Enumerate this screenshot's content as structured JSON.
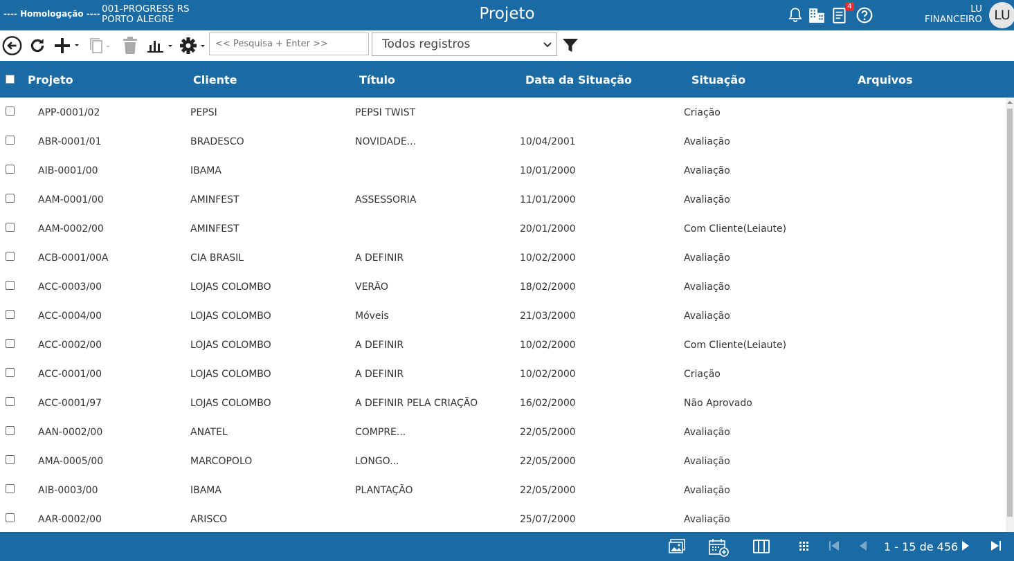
{
  "header": {
    "environment": "---- Homologação ----",
    "company_line1": "001-PROGRESS RS",
    "company_line2": "PORTO ALEGRE",
    "title": "Projeto",
    "notification_count": "4",
    "user_line1": "LU",
    "user_line2": "FINANCEIRO",
    "avatar_initials": "LU"
  },
  "toolbar": {
    "search_placeholder": "<< Pesquisa + Enter >>",
    "filter_selected": "Todos registros"
  },
  "table": {
    "columns": [
      "Projeto",
      "Cliente",
      "Título",
      "Data da Situação",
      "Situação",
      "Arquivos"
    ],
    "rows": [
      {
        "projeto": "APP-0001/02",
        "cliente": "PEPSI",
        "titulo": "PEPSI TWIST",
        "data": "",
        "situacao": "Criação"
      },
      {
        "projeto": "ABR-0001/01",
        "cliente": "BRADESCO",
        "titulo": "NOVIDADE...",
        "data": "10/04/2001",
        "situacao": "Avaliação"
      },
      {
        "projeto": "AIB-0001/00",
        "cliente": "IBAMA",
        "titulo": "",
        "data": "10/01/2000",
        "situacao": "Avaliação"
      },
      {
        "projeto": "AAM-0001/00",
        "cliente": "AMINFEST",
        "titulo": "ASSESSORIA",
        "data": "11/01/2000",
        "situacao": "Avaliação"
      },
      {
        "projeto": "AAM-0002/00",
        "cliente": "AMINFEST",
        "titulo": "",
        "data": "20/01/2000",
        "situacao": "Com Cliente(Leiaute)"
      },
      {
        "projeto": "ACB-0001/00A",
        "cliente": "CIA BRASIL",
        "titulo": "A DEFINIR",
        "data": "10/02/2000",
        "situacao": "Avaliação"
      },
      {
        "projeto": "ACC-0003/00",
        "cliente": "LOJAS COLOMBO",
        "titulo": "VERÃO",
        "data": "18/02/2000",
        "situacao": "Avaliação"
      },
      {
        "projeto": "ACC-0004/00",
        "cliente": "LOJAS COLOMBO",
        "titulo": "Móveis",
        "data": "21/03/2000",
        "situacao": "Avaliação"
      },
      {
        "projeto": "ACC-0002/00",
        "cliente": "LOJAS COLOMBO",
        "titulo": "A DEFINIR",
        "data": "10/02/2000",
        "situacao": "Com Cliente(Leiaute)"
      },
      {
        "projeto": "ACC-0001/00",
        "cliente": "LOJAS COLOMBO",
        "titulo": "A DEFINIR",
        "data": "10/02/2000",
        "situacao": "Criação"
      },
      {
        "projeto": "ACC-0001/97",
        "cliente": "LOJAS COLOMBO",
        "titulo": "A DEFINIR PELA CRIAÇÃO",
        "data": "16/02/2000",
        "situacao": "Não Aprovado"
      },
      {
        "projeto": "AAN-0002/00",
        "cliente": "ANATEL",
        "titulo": "COMPRE...",
        "data": "22/05/2000",
        "situacao": "Avaliação"
      },
      {
        "projeto": "AMA-0005/00",
        "cliente": "MARCOPOLO",
        "titulo": "LONGO...",
        "data": "22/05/2000",
        "situacao": "Avaliação"
      },
      {
        "projeto": "AIB-0003/00",
        "cliente": "IBAMA",
        "titulo": "PLANTAÇÃO",
        "data": "22/05/2000",
        "situacao": "Avaliação"
      },
      {
        "projeto": "AAR-0002/00",
        "cliente": "ARISCO",
        "titulo": "",
        "data": "25/07/2000",
        "situacao": "Avaliação"
      }
    ]
  },
  "footer": {
    "pagination": "1 - 15 de 456"
  }
}
